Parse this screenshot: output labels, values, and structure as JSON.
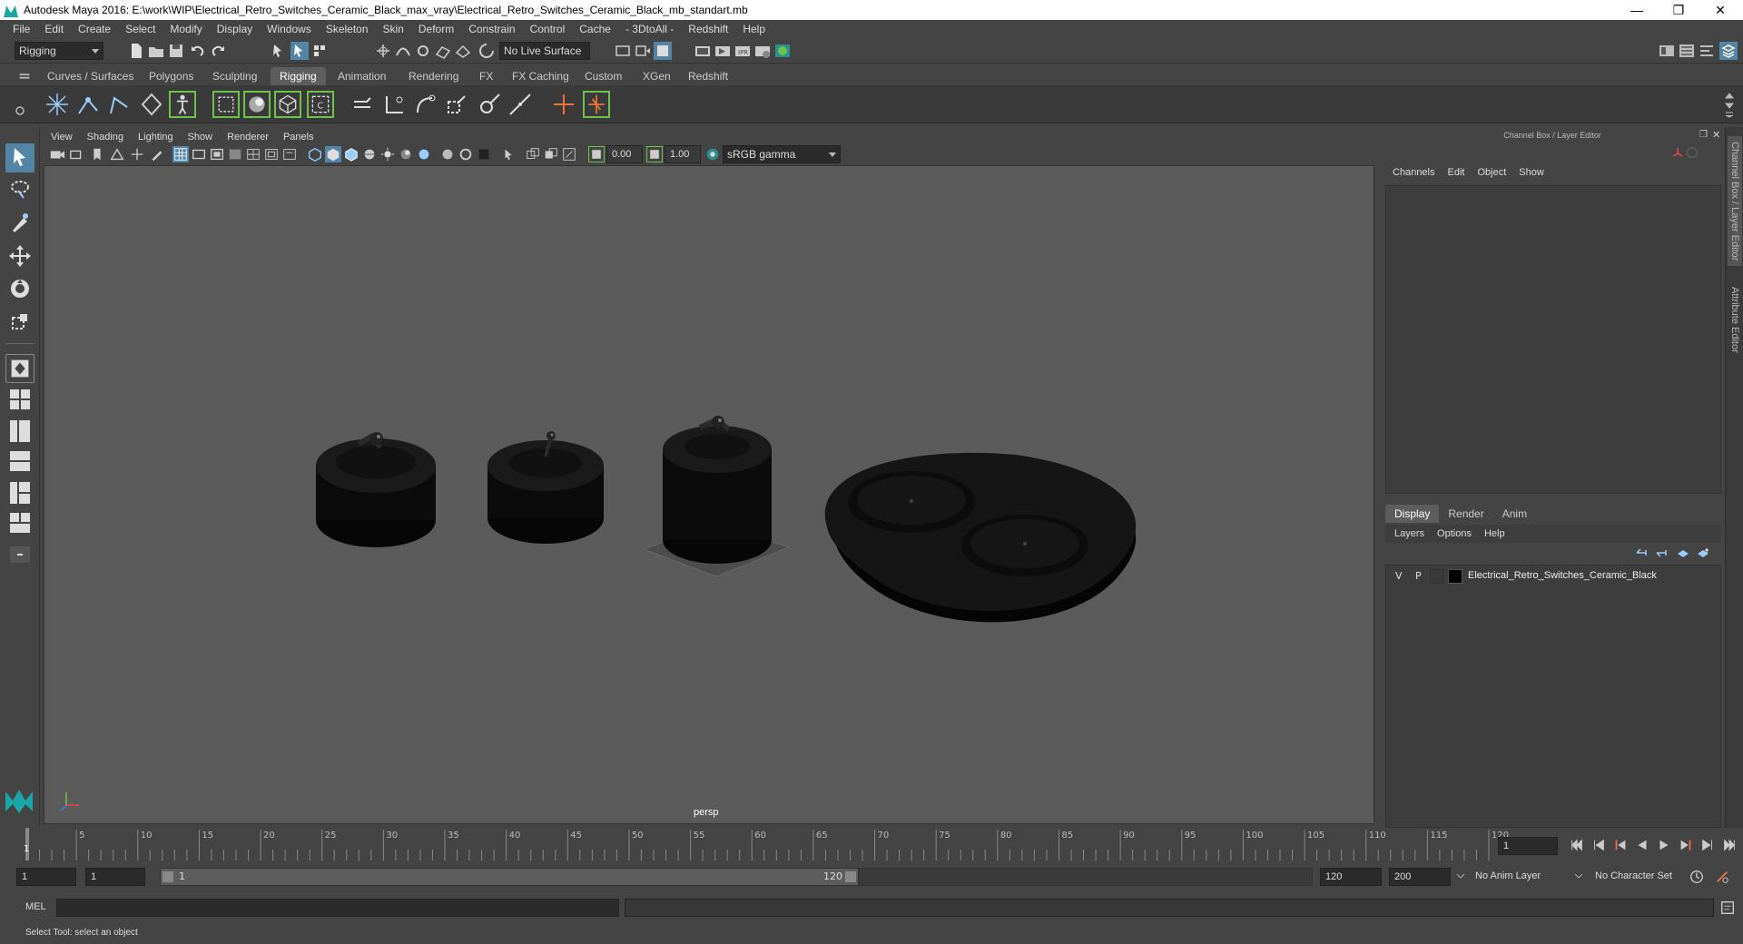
{
  "window": {
    "title": "Autodesk Maya 2016: E:\\work\\WIP\\Electrical_Retro_Switches_Ceramic_Black_max_vray\\Electrical_Retro_Switches_Ceramic_Black_mb_standart.mb",
    "controls": [
      "—",
      "❐",
      "✕"
    ]
  },
  "menubar": [
    "File",
    "Edit",
    "Create",
    "Select",
    "Modify",
    "Display",
    "Windows",
    "Skeleton",
    "Skin",
    "Deform",
    "Constrain",
    "Control",
    "Cache",
    "- 3DtoAll -",
    "Redshift",
    "Help"
  ],
  "statusline": {
    "mode": "Rigging",
    "live_surface": "No Live Surface"
  },
  "shelf_tabs": [
    "Curves / Surfaces",
    "Polygons",
    "Sculpting",
    "Rigging",
    "Animation",
    "Rendering",
    "FX",
    "FX Caching",
    "Custom",
    "XGen",
    "Redshift"
  ],
  "active_shelf_tab": "Rigging",
  "panel_menu": [
    "View",
    "Shading",
    "Lighting",
    "Show",
    "Renderer",
    "Panels"
  ],
  "panel_toolbar": {
    "exposure": "0.00",
    "gamma": "1.00",
    "color_space": "sRGB gamma"
  },
  "viewport": {
    "camera_label": "persp",
    "background": "#5b5b5b"
  },
  "channel_box": {
    "title": "Channel Box / Layer Editor",
    "menu": [
      "Channels",
      "Edit",
      "Object",
      "Show"
    ]
  },
  "layer_editor": {
    "tabs": [
      "Display",
      "Render",
      "Anim"
    ],
    "active_tab": "Display",
    "menu": [
      "Layers",
      "Options",
      "Help"
    ],
    "layers": [
      {
        "v": "V",
        "p": "P",
        "name": "Electrical_Retro_Switches_Ceramic_Black"
      }
    ]
  },
  "side_tabs": [
    "Channel Box / Layer Editor",
    "Attribute Editor"
  ],
  "timeline": {
    "ticks": [
      "5",
      "10",
      "15",
      "20",
      "25",
      "30",
      "35",
      "40",
      "45",
      "50",
      "55",
      "60",
      "65",
      "70",
      "75",
      "80",
      "85",
      "90",
      "95",
      "100",
      "105",
      "110",
      "115",
      "120"
    ],
    "start_label": "1",
    "current_frame": "1"
  },
  "range": {
    "start": "1",
    "playback_start": "1",
    "slider_left": "1",
    "slider_right": "120",
    "playback_end": "120",
    "end": "200",
    "anim_layer": "No Anim Layer",
    "character_set": "No Character Set"
  },
  "cmdline": {
    "label": "MEL"
  },
  "helpline": {
    "text": "Select Tool: select an object"
  },
  "colors": {
    "accent": "#5285a6",
    "shelf_green": "#6fc24b",
    "active_tab": "#5d5d5d"
  }
}
